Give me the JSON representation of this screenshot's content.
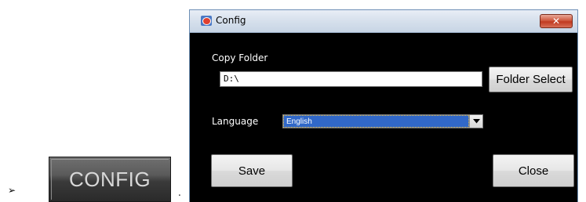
{
  "page": {
    "bullet": "➢",
    "config_button_label": "CONFIG",
    "trailing_dot": "."
  },
  "dialog": {
    "title": "Config",
    "close_icon": "✕",
    "copy_folder_label": "Copy Folder",
    "folder_value": "D:\\",
    "folder_select_label": "Folder Select",
    "language_label": "Language",
    "language_selected": "English",
    "save_label": "Save",
    "close_label": "Close"
  },
  "icons": {
    "title_icon": "app-icon",
    "close_icon": "close-icon",
    "dropdown_icon": "chevron-down-icon"
  },
  "colors": {
    "dialog_background": "#000000",
    "selection_highlight": "#3168c8",
    "close_button": "#c03a20",
    "titlebar": "#d6e0ec"
  }
}
